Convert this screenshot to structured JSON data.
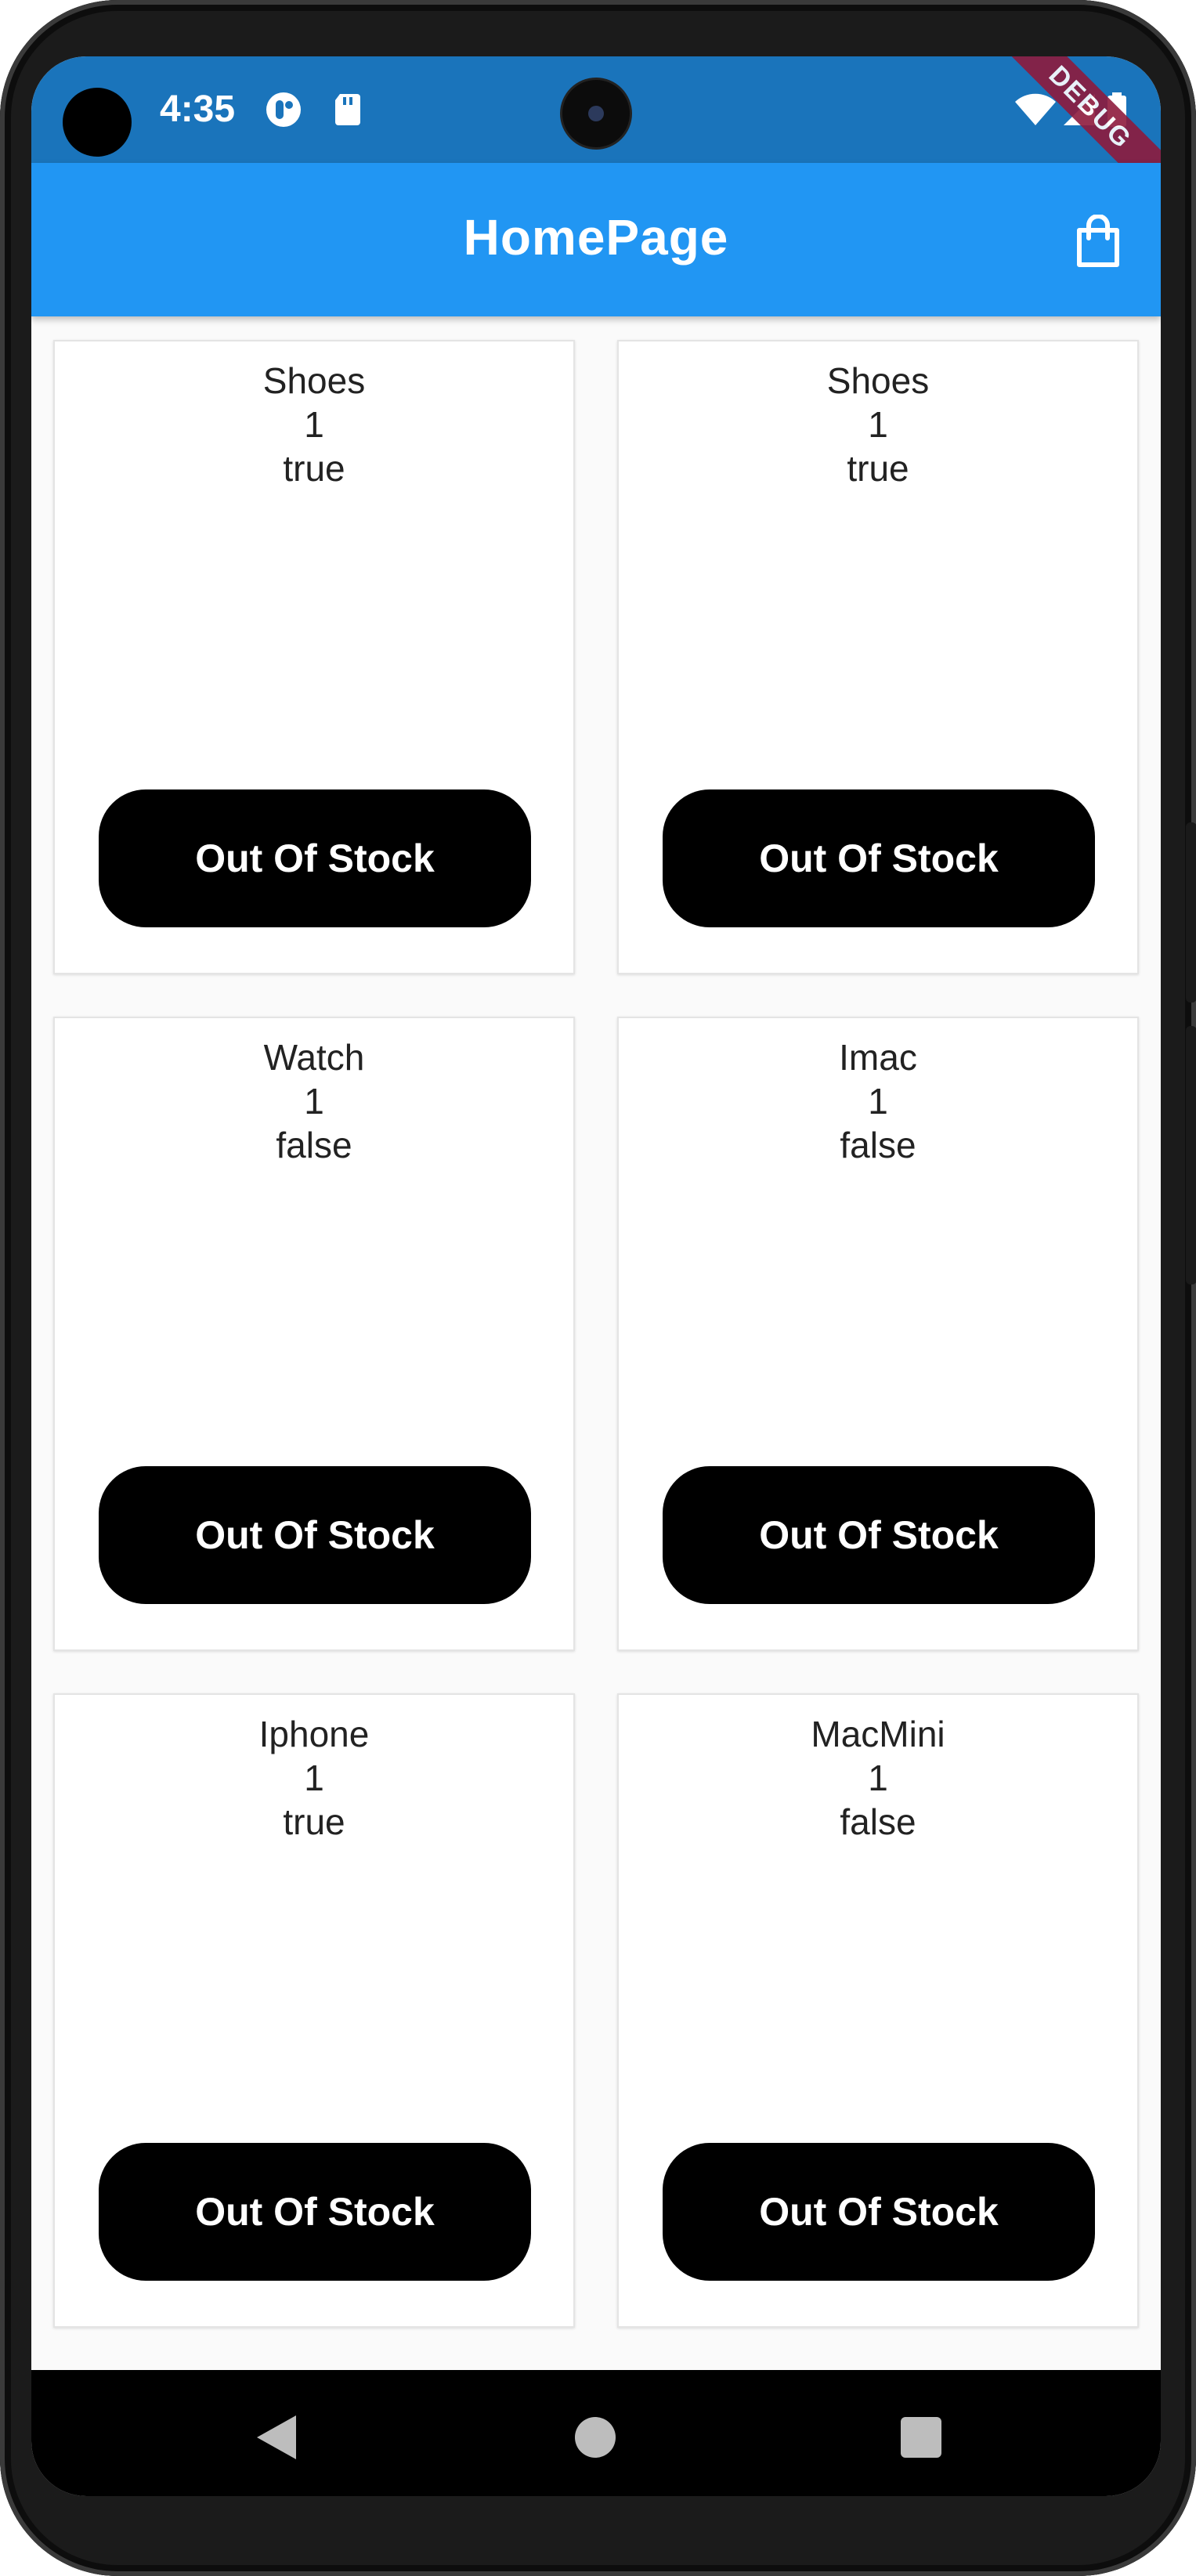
{
  "status_bar": {
    "time": "4:35",
    "icons": [
      "media-icon",
      "sd-card-icon",
      "wifi-icon",
      "signal-icon",
      "battery-icon"
    ],
    "debug_label": "DEBUG"
  },
  "app_bar": {
    "title": "HomePage",
    "cart_icon": "shopping-bag-icon",
    "color": "#2196f3"
  },
  "products": [
    {
      "name": "Shoes",
      "quantity": "1",
      "in_stock": "true",
      "button_label": "Out Of Stock"
    },
    {
      "name": "Shoes",
      "quantity": "1",
      "in_stock": "true",
      "button_label": "Out Of Stock"
    },
    {
      "name": "Watch",
      "quantity": "1",
      "in_stock": "false",
      "button_label": "Out Of Stock"
    },
    {
      "name": "Imac",
      "quantity": "1",
      "in_stock": "false",
      "button_label": "Out Of Stock"
    },
    {
      "name": "Iphone",
      "quantity": "1",
      "in_stock": "true",
      "button_label": "Out Of Stock"
    },
    {
      "name": "MacMini",
      "quantity": "1",
      "in_stock": "false",
      "button_label": "Out Of Stock"
    }
  ],
  "nav_bar": {
    "icons": [
      "back-icon",
      "home-icon",
      "recent-apps-icon"
    ]
  }
}
